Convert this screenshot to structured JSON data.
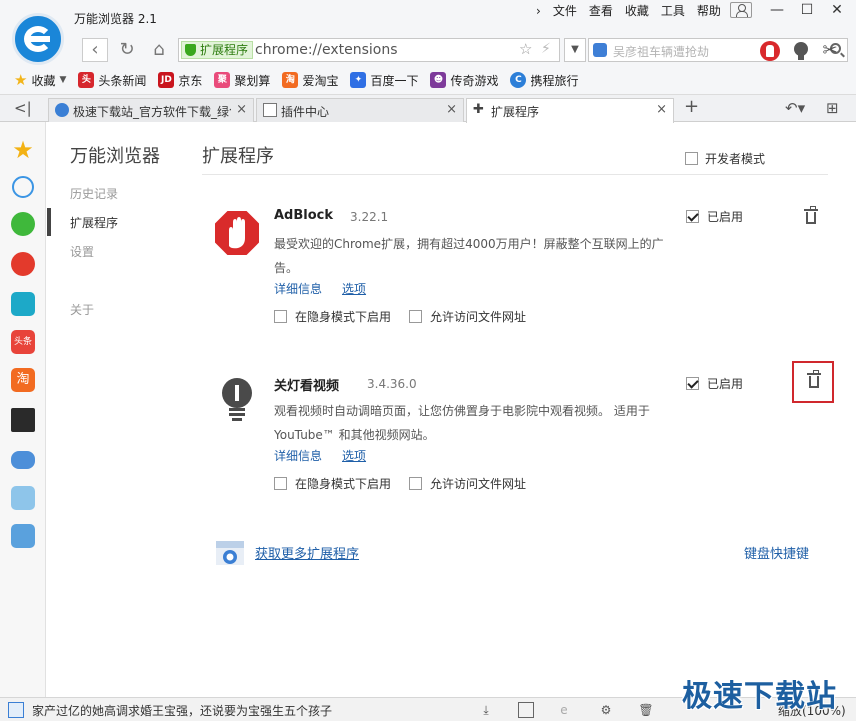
{
  "window": {
    "title": "万能浏览器 2.1",
    "menu": [
      "文件",
      "查看",
      "收藏",
      "工具",
      "帮助"
    ]
  },
  "nav": {
    "ext_badge": "扩展程序",
    "url": "chrome://extensions",
    "search_placeholder": "吴彦祖车辆遭抢劫"
  },
  "bookmarks": {
    "favorites_label": "收藏",
    "items": [
      {
        "label": "头条新闻",
        "icon": "toutiao-icon",
        "color": "#d6262d"
      },
      {
        "label": "京东",
        "icon": "jd-icon",
        "color": "#c9151e"
      },
      {
        "label": "聚划算",
        "icon": "juhuasuan-icon",
        "color": "#e94b7b"
      },
      {
        "label": "爱淘宝",
        "icon": "aitaobao-icon",
        "color": "#f26b21"
      },
      {
        "label": "百度一下",
        "icon": "baidu-icon",
        "color": "#2f6fe4"
      },
      {
        "label": "传奇游戏",
        "icon": "game-icon",
        "color": "#7d3a9a"
      },
      {
        "label": "携程旅行",
        "icon": "ctrip-icon",
        "color": "#2d7fd8"
      }
    ]
  },
  "tabs": [
    {
      "label": "极速下载站_官方软件下载_绿色",
      "active": false
    },
    {
      "label": "插件中心",
      "active": false
    },
    {
      "label": "扩展程序",
      "active": true
    }
  ],
  "sidebar": {
    "title": "万能浏览器",
    "items": [
      {
        "label": "历史记录",
        "active": false
      },
      {
        "label": "扩展程序",
        "active": true
      },
      {
        "label": "设置",
        "active": false
      },
      {
        "label": "",
        "active": false
      },
      {
        "label": "关于",
        "active": false
      }
    ]
  },
  "page": {
    "title": "扩展程序",
    "developer_mode": {
      "label": "开发者模式",
      "checked": false
    },
    "extensions": [
      {
        "name": "AdBlock",
        "version": "3.22.1",
        "description": "最受欢迎的Chrome扩展，拥有超过4000万用户！屏蔽整个互联网上的广告。",
        "details_link": "详细信息",
        "options_link": "选项",
        "incognito_label": "在隐身模式下启用",
        "file_access_label": "允许访问文件网址",
        "enabled_label": "已启用",
        "enabled": true
      },
      {
        "name": "关灯看视频",
        "version": "3.4.36.0",
        "description": "观看视频时自动调暗页面，让您仿佛置身于电影院中观看视频。 适用于 YouTube™ 和其他视频网站。",
        "details_link": "详细信息",
        "options_link": "选项",
        "incognito_label": "在隐身模式下启用",
        "file_access_label": "允许访问文件网址",
        "enabled_label": "已启用",
        "enabled": true
      }
    ],
    "more_link": "获取更多扩展程序",
    "shortcuts_link": "键盘快捷键"
  },
  "status": {
    "text": "家产过亿的她高调求婚王宝强，还说要为宝强生五个孩子",
    "zoom": "缩放(100%)",
    "watermark": "极速下载站"
  }
}
